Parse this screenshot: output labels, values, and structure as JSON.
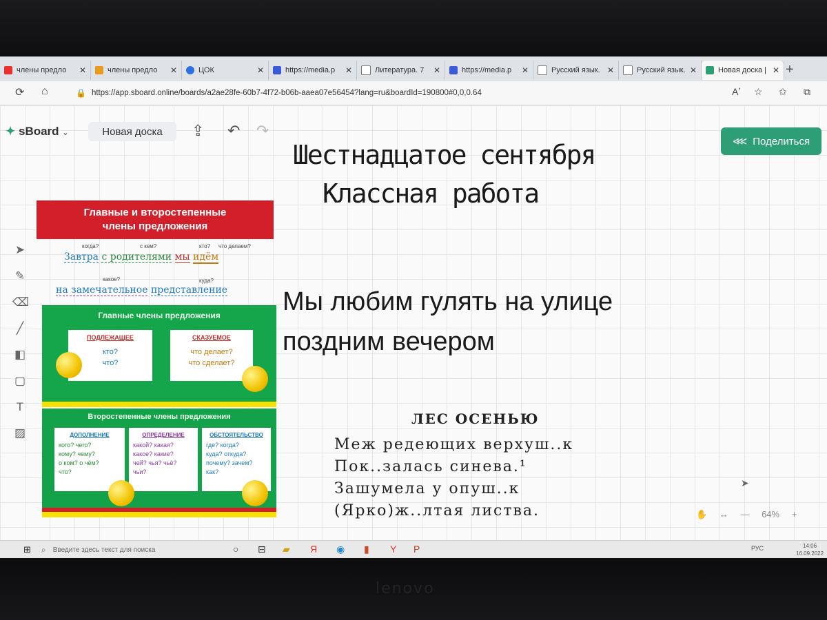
{
  "browser": {
    "tabs": [
      {
        "label": "члены предло",
        "color": "#e8322b",
        "active": false
      },
      {
        "label": "члены предло",
        "color": "#e89a1c",
        "active": false
      },
      {
        "label": "ЦОК",
        "color": "#2f6fe0",
        "active": false
      },
      {
        "label": "https://media.p",
        "color": "#3b5bd6",
        "active": false
      },
      {
        "label": "Литература. 7",
        "color": "#777777",
        "active": false
      },
      {
        "label": "https://media.p",
        "color": "#3b5bd6",
        "active": false
      },
      {
        "label": "Русский язык.",
        "color": "#777777",
        "active": false
      },
      {
        "label": "Русский язык.",
        "color": "#777777",
        "active": false
      },
      {
        "label": "Новая доска | s",
        "color": "#2e9e76",
        "active": true
      }
    ],
    "tab_close": "✕",
    "new_tab": "+",
    "url": "https://app.sboard.online/boards/a2ae28fe-60b7-4f72-b06b-aaea07e56454?lang=ru&boardId=190800#0,0,0.64"
  },
  "board": {
    "logo": "sBoard",
    "name": "Новая доска",
    "share_label": "Поделиться",
    "title": "Шестнадцатое сентября",
    "subtitle": "Классная работа",
    "sentence_line1": "Мы любим гулять  на улице",
    "sentence_line2": "поздним вечером",
    "zoom": "64%",
    "poem": {
      "title": "ЛЕС ОСЕНЬЮ",
      "lines": [
        "Меж редеющих верхуш..к",
        "Пок..залась синева.¹",
        "Зашумела у опуш..к",
        "(Ярко)ж..лтая листва."
      ]
    }
  },
  "poster": {
    "heading_line1": "Главные и второстепенные",
    "heading_line2": "члены предложения",
    "ex1_words": [
      "Завтра",
      "с родителями",
      "мы",
      "идём"
    ],
    "ex1_questions": [
      "когда?",
      "с кем?",
      "кто?",
      "что делаем?"
    ],
    "ex2_words": [
      "на замечательное",
      "представление"
    ],
    "ex2_questions": [
      "какое?",
      "куда?"
    ],
    "main_title": "Главные члены предложения",
    "subject": {
      "title": "ПОДЛЕЖАЩЕЕ",
      "questions": [
        "кто?",
        "что?"
      ]
    },
    "predicate": {
      "title": "СКАЗУЕМОЕ",
      "questions": [
        "что делает?",
        "что сделает?"
      ]
    },
    "secondary_title": "Второстепенные члены предложения",
    "object": {
      "title": "ДОПОЛНЕНИЕ",
      "questions": [
        "кого? чего?",
        "кому? чему?",
        "о ком? о чём?",
        "что?"
      ]
    },
    "attribute": {
      "title": "ОПРЕДЕЛЕНИЕ",
      "questions": [
        "какой? какая?",
        "какое? какие?",
        "чей? чья? чьё?",
        "чьи?"
      ]
    },
    "adverbial": {
      "title": "ОБСТОЯТЕЛЬСТВО",
      "questions": [
        "где? когда?",
        "куда? откуда?",
        "почему? зачем?",
        "как?"
      ]
    }
  },
  "taskbar": {
    "search_placeholder": "Введите здесь текст для поиска",
    "lang": "РУС",
    "time": "14:06",
    "date": "16.09.2022"
  },
  "laptop_brand": "lenovo"
}
